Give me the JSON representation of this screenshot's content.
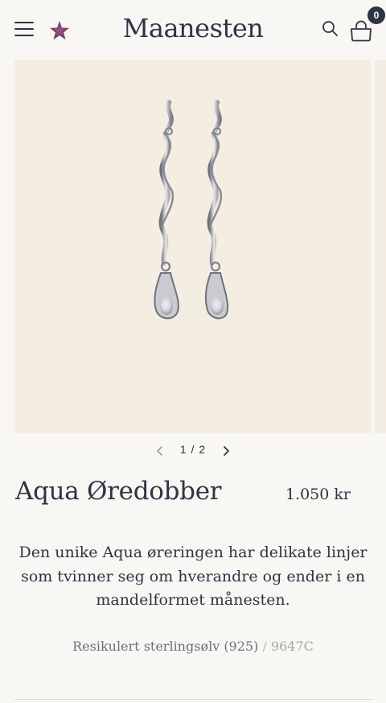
{
  "header": {
    "brand": "Maanesten",
    "cart_count": "0"
  },
  "gallery": {
    "current": "1",
    "total": "2",
    "separator": "/"
  },
  "product": {
    "title": "Aqua Øredobber",
    "price": "1.050 kr",
    "description": "Den unike Aqua øreringen har delikate linjer som tvinner seg om hverandre og ender i en mandelformet månesten.",
    "material": "Resikulert sterlingsølv (925)",
    "sku_separator": "/",
    "sku": "9647C"
  },
  "colors": {
    "text": "#2f3444",
    "image_bg": "#f4ede1",
    "page_bg": "#f8f7f4",
    "star_accent": "#7a3a66"
  },
  "icons": {
    "menu": "hamburger-icon",
    "logo": "star-icon",
    "search": "search-icon",
    "cart": "shopping-bag-icon",
    "prev": "chevron-left-icon",
    "next": "chevron-right-icon"
  }
}
